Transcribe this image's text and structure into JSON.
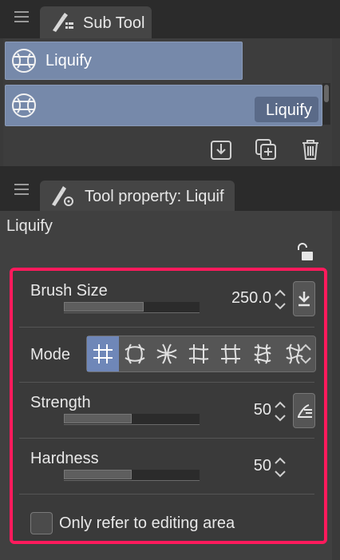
{
  "subtool_panel": {
    "tab_label": "Sub Tool",
    "items": [
      {
        "label": "Liquify",
        "selected": true
      },
      {
        "label": "Liquify",
        "selected": false
      }
    ],
    "actions": [
      "download-icon",
      "duplicate-icon",
      "trash-icon"
    ]
  },
  "tool_property_panel": {
    "tab_label": "Tool property: Liquif",
    "tool_name": "Liquify",
    "brush_size": {
      "label": "Brush Size",
      "value": "250.0",
      "fill_fraction": 0.59
    },
    "mode": {
      "label": "Mode",
      "selected_index": 0,
      "options_count": 7
    },
    "strength": {
      "label": "Strength",
      "value": "50",
      "fill_fraction": 0.5
    },
    "hardness": {
      "label": "Hardness",
      "value": "50",
      "fill_fraction": 0.5
    },
    "only_refer": {
      "label": "Only refer to editing area",
      "checked": false
    }
  },
  "colors": {
    "highlight_border": "#ff1a5c",
    "selection": "#7689aa",
    "mode_active": "#6f87b8"
  }
}
